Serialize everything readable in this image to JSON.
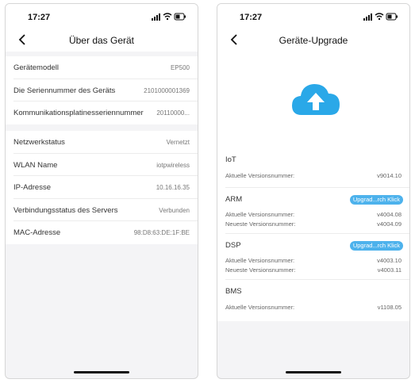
{
  "left": {
    "time": "17:27",
    "title": "Über das Gerät",
    "section1": [
      {
        "label": "Gerätemodell",
        "value": "EP500"
      },
      {
        "label": "Die Seriennummer des Geräts",
        "value": "2101000001369"
      },
      {
        "label": "Kommunikationsplatinesseriennummer",
        "value": "20110000..."
      }
    ],
    "section2": [
      {
        "label": "Netzwerkstatus",
        "value": "Vernetzt"
      },
      {
        "label": "WLAN Name",
        "value": "iotpwireless"
      },
      {
        "label": "IP-Adresse",
        "value": "10.16.16.35"
      },
      {
        "label": "Verbindungsstatus des Servers",
        "value": "Verbunden"
      },
      {
        "label": "MAC-Adresse",
        "value": "98:D8:63:DE:1F:BE"
      }
    ]
  },
  "right": {
    "time": "17:27",
    "title": "Geräte-Upgrade",
    "modules": [
      {
        "name": "IoT",
        "upgrade": "",
        "current_label": "Aktuelle Versionsnummer:",
        "current": "v9014.10",
        "latest_label": "",
        "latest": ""
      },
      {
        "name": "ARM",
        "upgrade": "Upgrad...rch Klick",
        "current_label": "Aktuelle Versionsnummer:",
        "current": "v4004.08",
        "latest_label": "Neueste Versionsnummer:",
        "latest": "v4004.09"
      },
      {
        "name": "DSP",
        "upgrade": "Upgrad...rch Klick",
        "current_label": "Aktuelle Versionsnummer:",
        "current": "v4003.10",
        "latest_label": "Neueste Versionsnummer:",
        "latest": "v4003.11"
      },
      {
        "name": "BMS",
        "upgrade": "",
        "current_label": "Aktuelle Versionsnummer:",
        "current": "v1108.05",
        "latest_label": "",
        "latest": ""
      }
    ]
  },
  "colors": {
    "accent": "#4db2ec",
    "background": "#f4f4f6"
  },
  "icons": {
    "back": "chevron-left-icon",
    "cloud": "cloud-upload-icon",
    "signal": "signal-icon",
    "wifi": "wifi-icon",
    "battery": "battery-icon"
  }
}
